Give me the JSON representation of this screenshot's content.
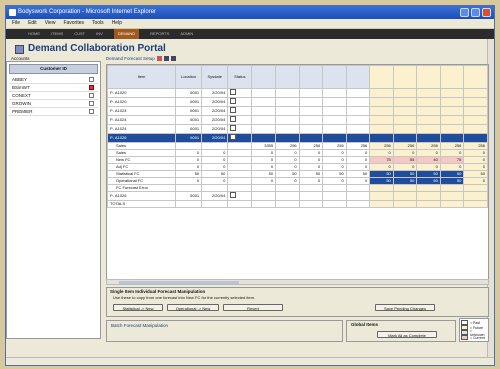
{
  "window": {
    "title": "Bodyswork Corporation - Microsoft Internet Explorer"
  },
  "menu": [
    "File",
    "Edit",
    "View",
    "Favorites",
    "Tools",
    "Help"
  ],
  "nav": [
    "HOME",
    "ITEMS",
    "CUST",
    "INV",
    "DEMAND",
    "REPORTS",
    "ADMIN"
  ],
  "portal": {
    "title": "Demand Collaboration Portal"
  },
  "accounts": {
    "section_label": "Accounts",
    "header": "Customer ID",
    "rows": [
      {
        "label": "ABBEY",
        "flag": false
      },
      {
        "label": "BSimWT",
        "flag": true
      },
      {
        "label": "CONEXT",
        "flag": false
      },
      {
        "label": "GROWIN",
        "flag": false
      },
      {
        "label": "PREMIER",
        "flag": false
      }
    ]
  },
  "forecast": {
    "title": "Demand Forecast Setup",
    "columns": [
      "Item",
      "Location",
      "Sysdate",
      "Status"
    ],
    "period_count": 10,
    "rows": [
      {
        "item": "P- A1020",
        "loc": "6001",
        "date": "2/20/04",
        "cb": true,
        "type": "item"
      },
      {
        "item": "P- A1020",
        "loc": "6001",
        "date": "2/20/04",
        "cb": true,
        "type": "item"
      },
      {
        "item": "P- A1024",
        "loc": "6001",
        "date": "2/20/04",
        "cb": true,
        "type": "item"
      },
      {
        "item": "P- A1024",
        "loc": "6001",
        "date": "2/20/04",
        "cb": true,
        "type": "item"
      },
      {
        "item": "P- A1024",
        "loc": "6001",
        "date": "2/20/04",
        "cb": true,
        "type": "item"
      },
      {
        "item": "P- A1026",
        "loc": "6001",
        "date": "2/20/04",
        "cb": true,
        "type": "selected"
      },
      {
        "item": "Sales",
        "loc": "",
        "date": "",
        "cb": false,
        "type": "sales",
        "vals": [
          "3355",
          "256",
          "256",
          "256",
          "256",
          "256",
          "256",
          "256",
          "256",
          "256"
        ]
      },
      {
        "item": "Sales",
        "loc": "0",
        "date": "0",
        "cb": false,
        "type": "sub",
        "vals": [
          "0",
          "0",
          "0",
          "0",
          "0",
          "0",
          "0",
          "0",
          "0",
          "0"
        ]
      },
      {
        "item": "New FC",
        "loc": "0",
        "date": "0",
        "cb": false,
        "type": "newfc",
        "vals": [
          "0",
          "0",
          "0",
          "0",
          "0",
          "75",
          "55",
          "40",
          "75",
          "0"
        ]
      },
      {
        "item": "Adj FC",
        "loc": "0",
        "date": "0",
        "cb": false,
        "type": "sub",
        "vals": [
          "0",
          "0",
          "0",
          "0",
          "0",
          "0",
          "0",
          "0",
          "0",
          "0"
        ]
      },
      {
        "item": "Statistical FC",
        "loc": "50",
        "date": "50",
        "cb": false,
        "type": "sub",
        "vals": [
          "50",
          "50",
          "50",
          "50",
          "50",
          "50",
          "50",
          "50",
          "50",
          "50"
        ]
      },
      {
        "item": "Operational FC",
        "loc": "0",
        "date": "0",
        "cb": false,
        "type": "sub",
        "vals": [
          "0",
          "0",
          "0",
          "0",
          "0",
          "50",
          "50",
          "50",
          "50",
          "0"
        ]
      },
      {
        "item": "FC Forecast Error",
        "loc": "",
        "date": "",
        "cb": false,
        "type": "sub",
        "vals": [
          "",
          "",
          "",
          "",
          "",
          "",
          "",
          "",
          "",
          ""
        ]
      },
      {
        "item": "P- A1026",
        "loc": "6001",
        "date": "2/20/04",
        "cb": true,
        "type": "item"
      },
      {
        "item": "TOTALS",
        "loc": "",
        "date": "",
        "cb": false,
        "type": "item"
      }
    ]
  },
  "notes": {
    "line1": "Single Item Individual Forecast Manipulation",
    "line2": "Use these to copy from one forecast into New FC for the currently selected item.",
    "buttons": [
      "Statistical -> New",
      "Operational -> New",
      "Revert",
      "Save Pending Changes"
    ]
  },
  "batch": {
    "label": "Batch Forecast Manipulation"
  },
  "global": {
    "label": "Global Items",
    "button": "Mark All as Complete"
  },
  "legend": [
    "= Past",
    "= Future",
    "= Unknown",
    "= Current"
  ],
  "colors": {
    "title_bar": "#1a4fb8",
    "selected_row": "#1f4d9c",
    "future_col": "#fbf1cf",
    "highlight": "#f7c7c4"
  }
}
